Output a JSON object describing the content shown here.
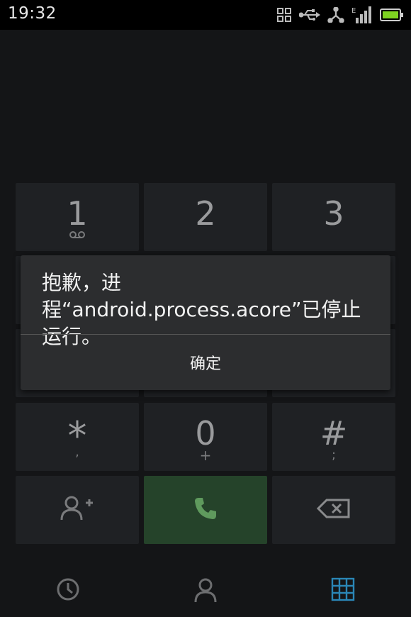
{
  "status_bar": {
    "time": "19:32",
    "icons": [
      "grid-apps-icon",
      "usb-icon",
      "usb-debug-icon",
      "signal-e-icon",
      "battery-icon"
    ],
    "network_type": "E"
  },
  "dialpad": {
    "keys": [
      {
        "digit": "1",
        "sub": "voicemail-icon"
      },
      {
        "digit": "2",
        "sub": ""
      },
      {
        "digit": "3",
        "sub": ""
      },
      {
        "digit": "*",
        "sub": ","
      },
      {
        "digit": "0",
        "sub": "+"
      },
      {
        "digit": "#",
        "sub": ";"
      }
    ],
    "actions": [
      "add-contact-icon",
      "call-icon",
      "backspace-icon"
    ]
  },
  "dialog": {
    "message": "抱歉，进程“android.process.acore”已停止运行。",
    "button_label": "确定"
  },
  "bottom_nav": {
    "tabs": [
      "call-log-icon",
      "contacts-icon",
      "dialpad-icon"
    ],
    "active_tab": "dialpad-icon",
    "active_color": "#2a86b6"
  },
  "colors": {
    "call_button": "#25432a",
    "call_icon": "#5f9a5d",
    "key_background": "#1f2124"
  }
}
